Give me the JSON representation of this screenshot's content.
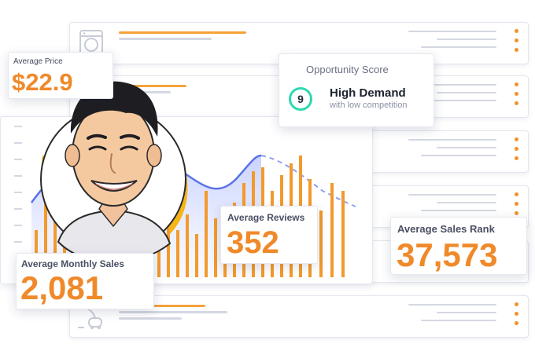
{
  "stats": {
    "avg_price_label": "Average Price",
    "avg_price_value": "$22.9",
    "avg_monthly_sales_label": "Average Monthly Sales",
    "avg_monthly_sales_value": "2,081",
    "avg_reviews_label": "Average Reviews",
    "avg_reviews_value": "352",
    "avg_sales_rank_label": "Average Sales Rank",
    "avg_sales_rank_value": "37,573"
  },
  "opportunity": {
    "title": "Opportunity Score",
    "score": "9",
    "headline": "High Demand",
    "subline": "with low competition"
  },
  "colors": {
    "accent_orange": "#f0892a",
    "score_ring": "#2ed8b2",
    "trend_line": "#5a72e6"
  },
  "icons": [
    "washing-machine-icon",
    "vacuum-icon",
    "kebab-menu-icon"
  ]
}
